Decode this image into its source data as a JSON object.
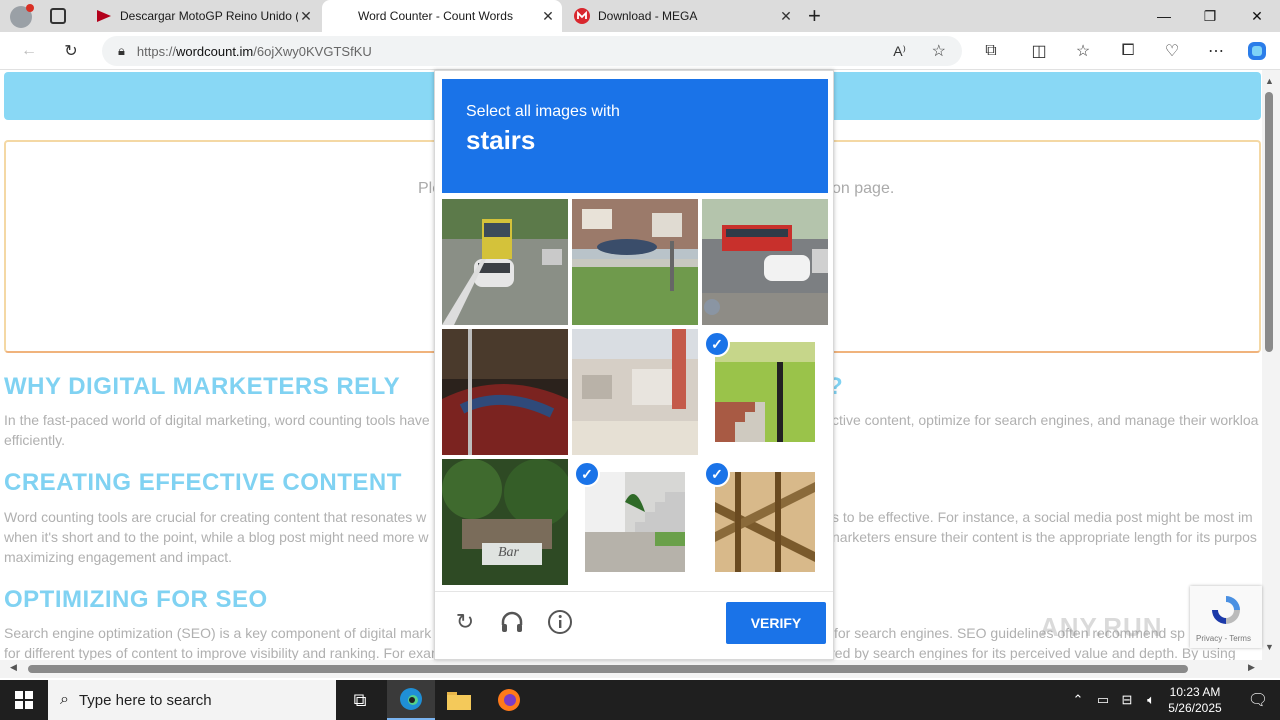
{
  "browser": {
    "tabs": [
      {
        "title": "Descargar MotoGP Reino Unido ("
      },
      {
        "title": "Word Counter - Count Words"
      },
      {
        "title": "Download - MEGA"
      }
    ],
    "url_prefix": "https://",
    "url_host": "wordcount.im",
    "url_path": "/6ojXwy0KVGTSfKU",
    "new_tab_symbol": "+"
  },
  "page": {
    "placeholder_left": "Ple",
    "placeholder_right": "on page.",
    "heading1": "WHY DIGITAL MARKETERS RELY",
    "heading1_tail": "?",
    "para1_left_l1": "In the fast-paced world of digital marketing, word counting tools have",
    "para1_right_l1": "ctive content, optimize for search engines, and manage their workloa",
    "para1_l2": "efficiently.",
    "heading2": "CREATING EFFECTIVE CONTENT",
    "para2_left_l1": "Word counting tools are crucial for creating content that resonates w",
    "para2_right_l1": "s to be effective. For instance, a social media post might be most im",
    "para2_left_l2": "when it's short and to the point, while a blog post might need more w",
    "para2_right_l2": "narketers ensure their content is the appropriate length for its purpos",
    "para2_l3": "maximizing engagement and impact.",
    "heading3": "OPTIMIZING FOR SEO",
    "para3_left_l1": "Search engine optimization (SEO) is a key component of digital mark",
    "para3_right_l1": "for search engines. SEO guidelines often recommend sp",
    "para3_l2": "for different types of content to improve visibility and ranking. For example, long-form content, typically over 1,500 words, is often favored by search engines for its perceived value and depth. By using"
  },
  "captcha": {
    "instruction": "Select all images with",
    "target": "stairs",
    "verify_label": "VERIFY",
    "tiles": [
      {
        "name": "street-bus",
        "selected": false
      },
      {
        "name": "house-boat",
        "selected": false
      },
      {
        "name": "street-cars",
        "selected": false
      },
      {
        "name": "car-dark",
        "selected": false
      },
      {
        "name": "building",
        "selected": false
      },
      {
        "name": "stairs-1",
        "selected": true
      },
      {
        "name": "tree-sign",
        "selected": false
      },
      {
        "name": "stairs-2",
        "selected": true
      },
      {
        "name": "stairs-3",
        "selected": true
      }
    ],
    "sign_text": "Bar"
  },
  "badge": {
    "text": "Privacy - Terms"
  },
  "watermark": {
    "text": "ANY.RUN"
  },
  "taskbar": {
    "search_placeholder": "Type here to search",
    "time": "10:23 AM",
    "date": "5/26/2025"
  }
}
